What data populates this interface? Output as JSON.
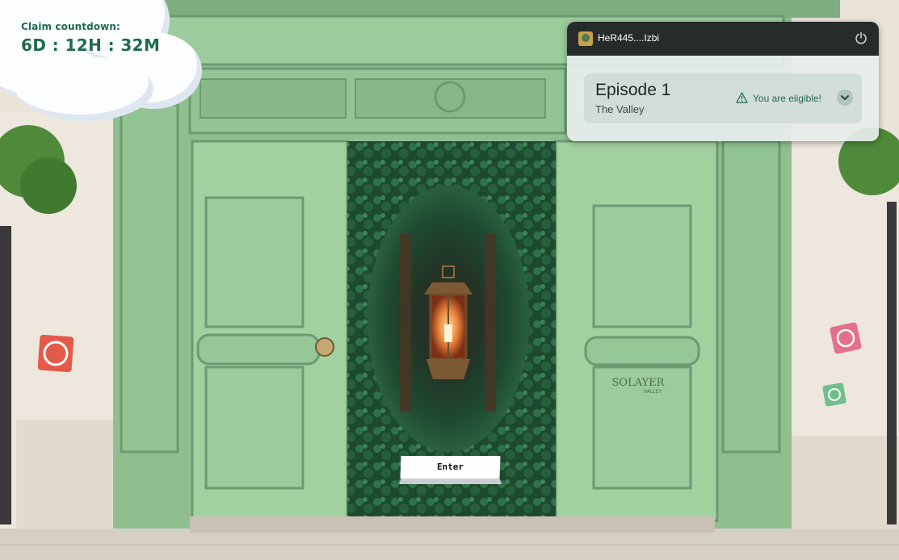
{
  "countdown": {
    "label": "Claim countdown:",
    "value": "6D : 12H : 32M"
  },
  "wallet": {
    "address": "HeR445....Izbi",
    "power_icon": "power-icon",
    "avatar_icon": "avatar-icon"
  },
  "episode": {
    "title": "Episode 1",
    "subtitle": "The Valley",
    "status": "You are eligible!",
    "warning_icon": "warning-triangle-icon",
    "expand_icon": "chevron-down-icon"
  },
  "scene": {
    "sign_brand": "SOLAYER",
    "sign_sub": "VALLEY"
  },
  "cta": {
    "enter_label": "Enter"
  },
  "colors": {
    "door_green": "#9ccb9c",
    "accent_green": "#1f6b4f",
    "panel_dark": "#262c2a",
    "wall": "#ece6dc"
  }
}
